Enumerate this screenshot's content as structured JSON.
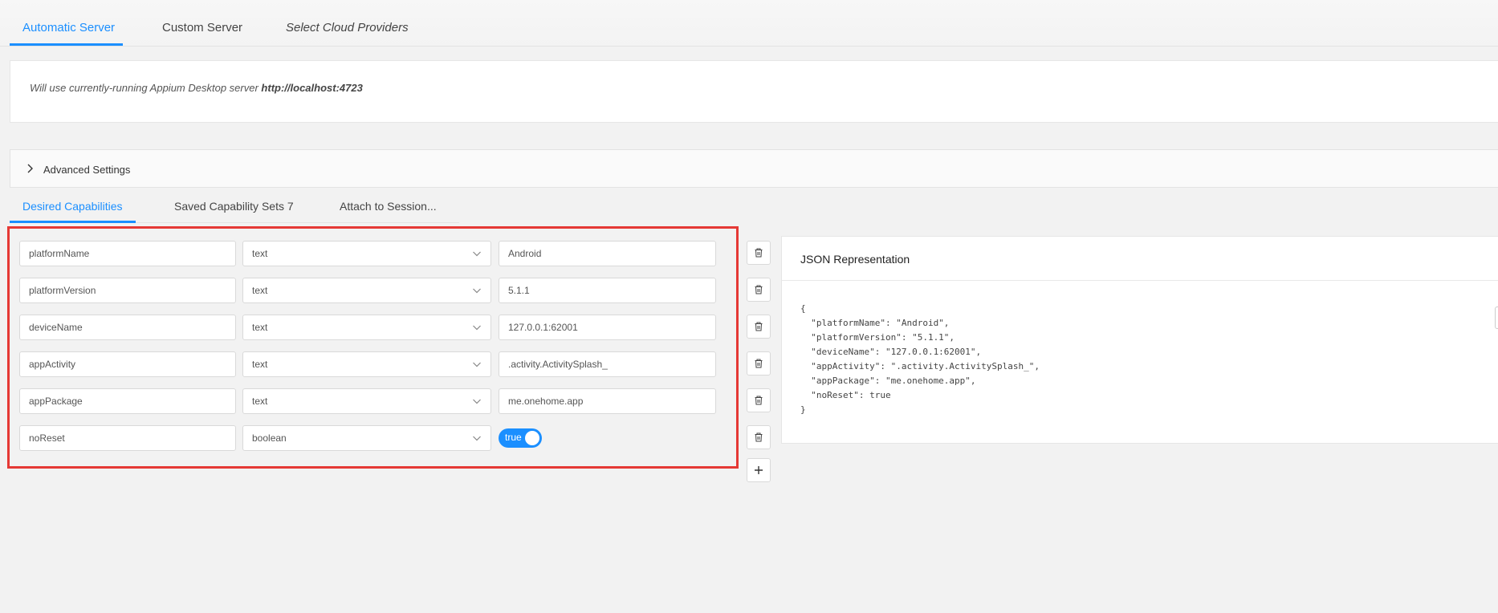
{
  "server_tabs": [
    {
      "label": "Automatic Server",
      "active": true
    },
    {
      "label": "Custom Server",
      "active": false
    },
    {
      "label": "Select Cloud Providers",
      "active": false
    }
  ],
  "server_info": {
    "prefix": "Will use currently-running Appium Desktop server",
    "url": "http://localhost:4723"
  },
  "advanced_settings": {
    "label": "Advanced Settings",
    "expanded": false
  },
  "capability_tabs": [
    {
      "label": "Desired Capabilities",
      "active": true
    },
    {
      "label": "Saved Capability Sets 7",
      "active": false
    },
    {
      "label": "Attach to Session...",
      "active": false
    }
  ],
  "capabilities": [
    {
      "name": "platformName",
      "type": "text",
      "value": "Android"
    },
    {
      "name": "platformVersion",
      "type": "text",
      "value": "5.1.1"
    },
    {
      "name": "deviceName",
      "type": "text",
      "value": "127.0.0.1:62001"
    },
    {
      "name": "appActivity",
      "type": "text",
      "value": ".activity.ActivitySplash_"
    },
    {
      "name": "appPackage",
      "type": "text",
      "value": "me.onehome.app"
    },
    {
      "name": "noReset",
      "type": "boolean",
      "value": "true"
    }
  ],
  "json_panel": {
    "title": "JSON Representation",
    "lines": [
      "{",
      "  \"platformName\": \"Android\",",
      "  \"platformVersion\": \"5.1.1\",",
      "  \"deviceName\": \"127.0.0.1:62001\",",
      "  \"appActivity\": \".activity.ActivitySplash_\",",
      "  \"appPackage\": \"me.onehome.app\",",
      "  \"noReset\": true",
      "}"
    ]
  },
  "colors": {
    "accent": "#1b8fff",
    "highlight_border": "#e53935",
    "background": "#f2f2f2"
  },
  "icons": {
    "advanced": "chevron-right-icon",
    "type_dropdown": "chevron-down-icon",
    "delete": "trash-icon",
    "add": "plus-icon"
  }
}
